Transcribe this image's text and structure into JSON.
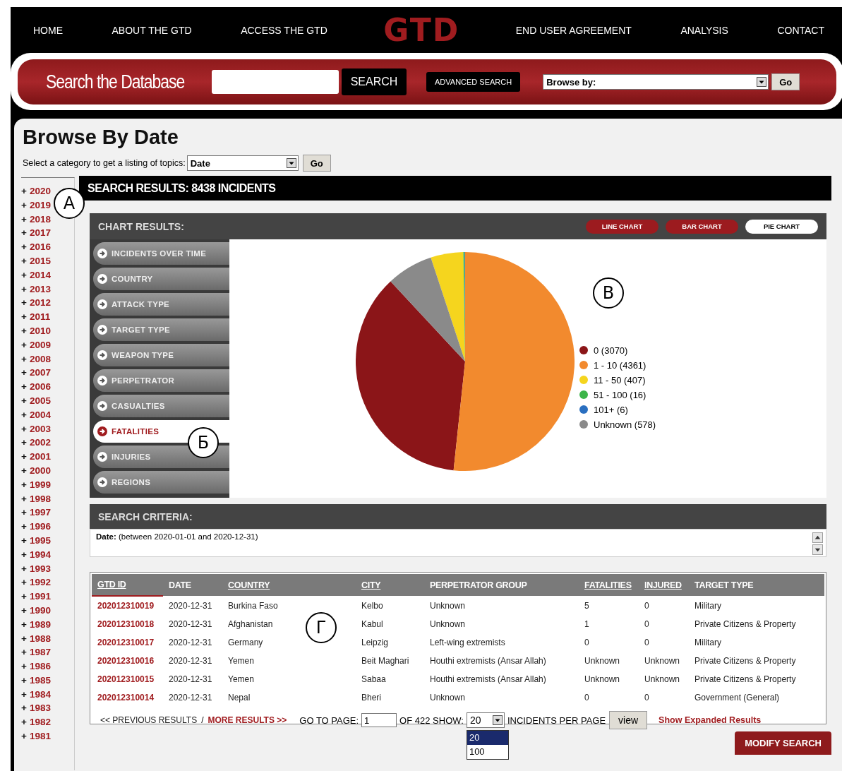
{
  "nav": {
    "left": [
      "HOME",
      "ABOUT THE GTD",
      "ACCESS THE GTD"
    ],
    "logo": "GTD",
    "right": [
      "END USER AGREEMENT",
      "ANALYSIS",
      "CONTACT"
    ]
  },
  "search_bar": {
    "title": "Search the Database",
    "search_button": "SEARCH",
    "advanced_button": "ADVANCED SEARCH",
    "browse_select": "Browse by:",
    "go_button": "Go"
  },
  "page": {
    "title": "Browse By Date",
    "category_prompt": "Select a category to get a listing of topics:",
    "category_select": "Date",
    "go_button": "Go"
  },
  "years": [
    {
      "toggle": "+",
      "label": "2020"
    },
    {
      "toggle": "+",
      "label": "2019"
    },
    {
      "toggle": "+",
      "label": "2018"
    },
    {
      "toggle": "+",
      "label": "2017"
    },
    {
      "toggle": "+",
      "label": "2016"
    },
    {
      "toggle": "+",
      "label": "2015"
    },
    {
      "toggle": "+",
      "label": "2014"
    },
    {
      "toggle": "+",
      "label": "2013"
    },
    {
      "toggle": "+",
      "label": "2012"
    },
    {
      "toggle": "+",
      "label": "2011"
    },
    {
      "toggle": "+",
      "label": "2010"
    },
    {
      "toggle": "+",
      "label": "2009"
    },
    {
      "toggle": "+",
      "label": "2008"
    },
    {
      "toggle": "+",
      "label": "2007"
    },
    {
      "toggle": "+",
      "label": "2006"
    },
    {
      "toggle": "+",
      "label": "2005"
    },
    {
      "toggle": "+",
      "label": "2004"
    },
    {
      "toggle": "+",
      "label": "2003"
    },
    {
      "toggle": "+",
      "label": "2002"
    },
    {
      "toggle": "+",
      "label": "2001"
    },
    {
      "toggle": "+",
      "label": "2000"
    },
    {
      "toggle": "+",
      "label": "1999"
    },
    {
      "toggle": "+",
      "label": "1998"
    },
    {
      "toggle": "+",
      "label": "1997"
    },
    {
      "toggle": "+",
      "label": "1996"
    },
    {
      "toggle": "+",
      "label": "1995"
    },
    {
      "toggle": "+",
      "label": "1994"
    },
    {
      "toggle": "+",
      "label": "1993"
    },
    {
      "toggle": "+",
      "label": "1992"
    },
    {
      "toggle": "+",
      "label": "1991"
    },
    {
      "toggle": "+",
      "label": "1990"
    },
    {
      "toggle": "+",
      "label": "1989"
    },
    {
      "toggle": "+",
      "label": "1988"
    },
    {
      "toggle": "+",
      "label": "1987"
    },
    {
      "toggle": "+",
      "label": "1986"
    },
    {
      "toggle": "+",
      "label": "1985"
    },
    {
      "toggle": "+",
      "label": "1984"
    },
    {
      "toggle": "+",
      "label": "1983"
    },
    {
      "toggle": "+",
      "label": "1982"
    },
    {
      "toggle": "+",
      "label": "1981"
    }
  ],
  "results_title": "SEARCH RESULTS: 8438 INCIDENTS",
  "chart_panel": {
    "title": "CHART RESULTS:",
    "chart_types": [
      {
        "label": "LINE CHART",
        "selected": false
      },
      {
        "label": "BAR CHART",
        "selected": false
      },
      {
        "label": "PIE CHART",
        "selected": true
      }
    ],
    "menu": [
      {
        "label": "INCIDENTS OVER TIME",
        "selected": false
      },
      {
        "label": "COUNTRY",
        "selected": false
      },
      {
        "label": "ATTACK TYPE",
        "selected": false
      },
      {
        "label": "TARGET TYPE",
        "selected": false
      },
      {
        "label": "WEAPON TYPE",
        "selected": false
      },
      {
        "label": "PERPETRATOR",
        "selected": false
      },
      {
        "label": "CASUALTIES",
        "selected": false
      },
      {
        "label": "FATALITIES",
        "selected": true
      },
      {
        "label": "INJURIES",
        "selected": false
      },
      {
        "label": "REGIONS",
        "selected": false
      }
    ],
    "chart_data": {
      "type": "pie",
      "categories": [
        "0 (3070)",
        "1 - 10 (4361)",
        "11 - 50 (407)",
        "51 - 100 (16)",
        "101+ (6)",
        "Unknown (578)"
      ],
      "series": [
        {
          "values": [
            3070,
            4361,
            407,
            16,
            6,
            578
          ]
        }
      ],
      "colors": [
        "#8b1518",
        "#f28a2e",
        "#f5d51e",
        "#3db54a",
        "#2a6fc0",
        "#8a8a8a"
      ]
    }
  },
  "criteria": {
    "title": "SEARCH CRITERIA:",
    "text": "**Date:** (between 2020-01-01 and 2020-12-31)"
  },
  "table": {
    "columns": [
      {
        "label": "GTD ID",
        "link": true
      },
      {
        "label": "DATE",
        "link": false
      },
      {
        "label": "COUNTRY",
        "link": true
      },
      {
        "label": "CITY",
        "link": true
      },
      {
        "label": "PERPETRATOR GROUP",
        "link": false
      },
      {
        "label": "FATALITIES",
        "link": true
      },
      {
        "label": "INJURED",
        "link": true
      },
      {
        "label": "TARGET TYPE",
        "link": false
      }
    ],
    "rows": [
      [
        "202012310019",
        "2020-12-31",
        "Burkina Faso",
        "Kelbo",
        "Unknown",
        "5",
        "0",
        "Military"
      ],
      [
        "202012310018",
        "2020-12-31",
        "Afghanistan",
        "Kabul",
        "Unknown",
        "1",
        "0",
        "Private Citizens & Property"
      ],
      [
        "202012310017",
        "2020-12-31",
        "Germany",
        "Leipzig",
        "Left-wing extremists",
        "0",
        "0",
        "Military"
      ],
      [
        "202012310016",
        "2020-12-31",
        "Yemen",
        "Beit Maghari",
        "Houthi extremists (Ansar Allah)",
        "Unknown",
        "Unknown",
        "Private Citizens & Property"
      ],
      [
        "202012310015",
        "2020-12-31",
        "Yemen",
        "Sabaa",
        "Houthi extremists (Ansar Allah)",
        "Unknown",
        "Unknown",
        "Private Citizens & Property"
      ],
      [
        "202012310014",
        "2020-12-31",
        "Nepal",
        "Bheri",
        "Unknown",
        "0",
        "0",
        "Government (General)"
      ]
    ]
  },
  "pager": {
    "previous": "<< PREVIOUS RESULTS",
    "separator": "/",
    "more": "MORE RESULTS >>",
    "goto_label": "GO TO PAGE:",
    "page_value": "1",
    "of_label": "OF 422 SHOW:",
    "per_page": "20",
    "options": [
      {
        "label": "20",
        "selected": true
      },
      {
        "label": "100",
        "selected": false
      }
    ],
    "per_page_label": "INCIDENTS PER PAGE",
    "view_button": "view",
    "expanded_link": "Show Expanded Results"
  },
  "modify_button": "MODIFY SEARCH",
  "annotations": [
    "А",
    "Б",
    "В",
    "Г"
  ]
}
